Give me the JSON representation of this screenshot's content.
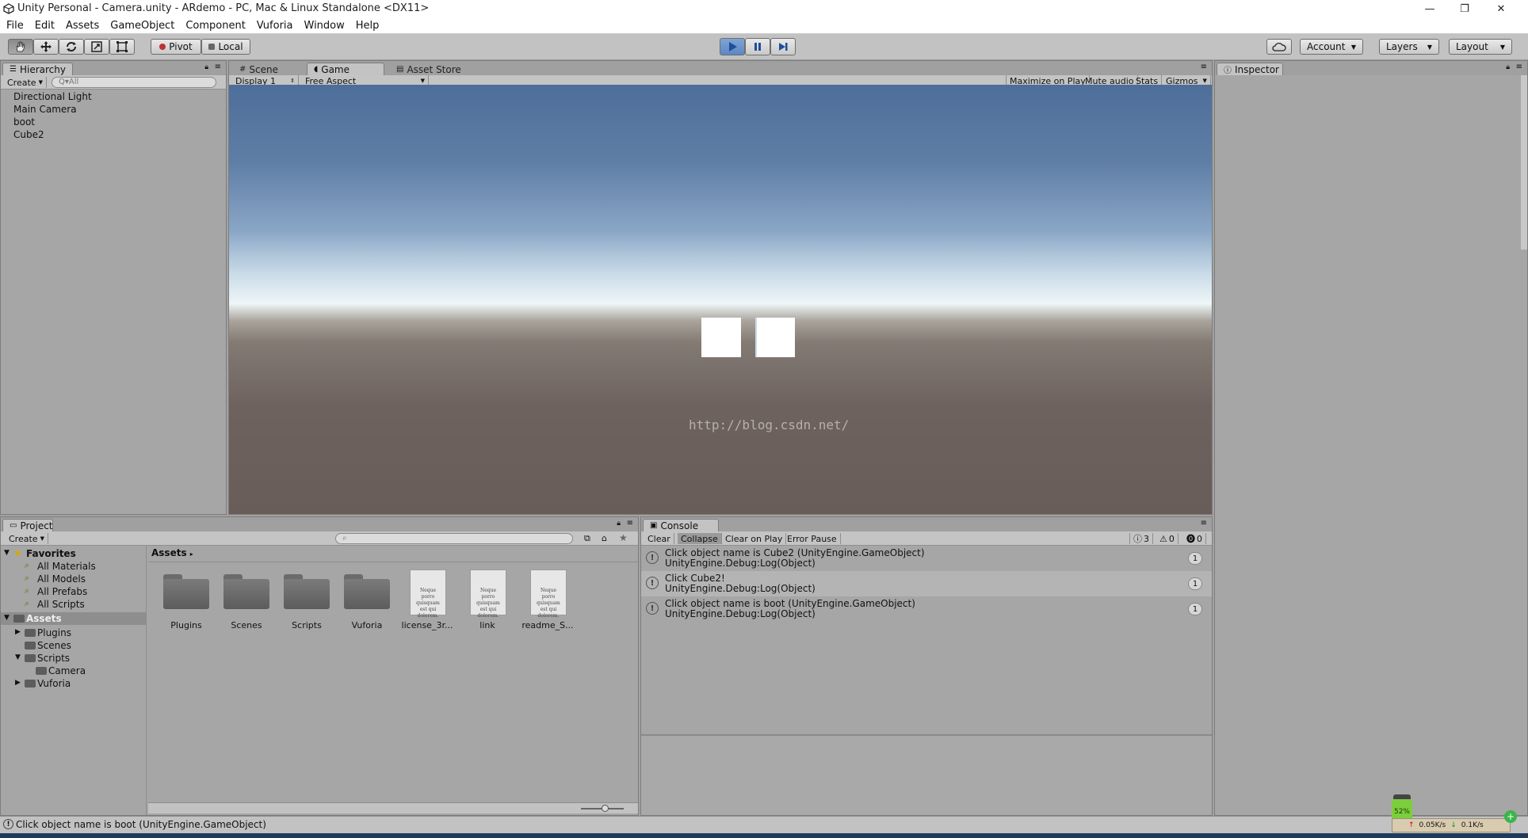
{
  "window": {
    "title": "Unity Personal - Camera.unity - ARdemo - PC, Mac & Linux Standalone <DX11>",
    "controls": {
      "minimize": "—",
      "restore": "❐",
      "close": "✕"
    }
  },
  "menu": [
    "File",
    "Edit",
    "Assets",
    "GameObject",
    "Component",
    "Vuforia",
    "Window",
    "Help"
  ],
  "toolbar": {
    "pivot_label": "Pivot",
    "local_label": "Local",
    "account_label": "Account",
    "layers_label": "Layers",
    "layout_label": "Layout"
  },
  "hierarchy": {
    "tab_label": "Hierarchy",
    "create_label": "Create",
    "search_placeholder": "Q▾All",
    "items": [
      "Directional Light",
      "Main Camera",
      "boot",
      "Cube2"
    ]
  },
  "center_tabs": {
    "scene": "Scene",
    "game": "Game",
    "asset_store": "Asset Store"
  },
  "game_view": {
    "display": "Display 1",
    "aspect": "Free Aspect",
    "maximize": "Maximize on Play",
    "mute": "Mute audio",
    "stats": "Stats",
    "gizmos": "Gizmos",
    "watermark": "http://blog.csdn.net/"
  },
  "inspector": {
    "tab_label": "Inspector"
  },
  "project": {
    "tab_label": "Project",
    "create_label": "Create",
    "favorites_label": "Favorites",
    "favorites": [
      "All Materials",
      "All Models",
      "All Prefabs",
      "All Scripts"
    ],
    "assets_label": "Assets",
    "tree": [
      "Plugins",
      "Scenes",
      "Scripts",
      "Camera",
      "Vuforia"
    ],
    "breadcrumb": "Assets",
    "items": [
      {
        "name": "Plugins",
        "type": "folder"
      },
      {
        "name": "Scenes",
        "type": "folder"
      },
      {
        "name": "Scripts",
        "type": "folder"
      },
      {
        "name": "Vuforia",
        "type": "folder"
      },
      {
        "name": "license_3r...",
        "type": "doc"
      },
      {
        "name": "link",
        "type": "doc"
      },
      {
        "name": "readme_S...",
        "type": "doc"
      }
    ],
    "doc_preview_text": "Neque porro quisquam est qui dolorem."
  },
  "console": {
    "tab_label": "Console",
    "clear": "Clear",
    "collapse": "Collapse",
    "clear_on_play": "Clear on Play",
    "error_pause": "Error Pause",
    "count_info": "3",
    "count_warn": "0",
    "count_error": "0",
    "entries": [
      {
        "line1": "Click object name is Cube2 (UnityEngine.GameObject)",
        "line2": "UnityEngine.Debug:Log(Object)",
        "count": "1"
      },
      {
        "line1": "Click Cube2!",
        "line2": "UnityEngine.Debug:Log(Object)",
        "count": "1"
      },
      {
        "line1": "Click object name is boot (UnityEngine.GameObject)",
        "line2": "UnityEngine.Debug:Log(Object)",
        "count": "1"
      }
    ]
  },
  "status": {
    "message": "Click object name is boot (UnityEngine.GameObject)",
    "net_percent": "52%",
    "net_up": "0.05K/s",
    "net_down": "0.1K/s"
  },
  "colors": {
    "panel": "#a6a6a6",
    "toolbar": "#c2c2c2",
    "play_blue": "#5d87c2"
  }
}
